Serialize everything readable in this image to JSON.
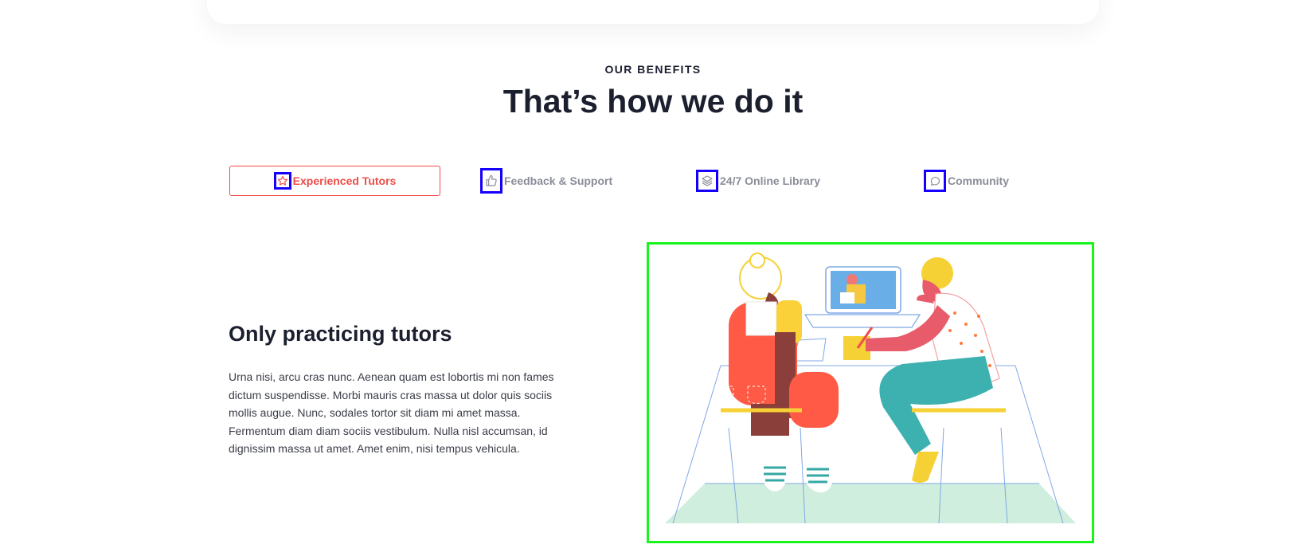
{
  "section": {
    "eyebrow": "OUR BENEFITS",
    "headline": "That’s how we do it"
  },
  "tabs": [
    {
      "label": "Experienced Tutors",
      "icon": "star-icon",
      "active": true
    },
    {
      "label": "Feedback & Support",
      "icon": "thumbs-up-icon",
      "active": false
    },
    {
      "label": "24/7 Online Library",
      "icon": "layers-icon",
      "active": false
    },
    {
      "label": "Community",
      "icon": "chat-icon",
      "active": false
    }
  ],
  "content": {
    "title": "Only practicing tutors",
    "body": "Urna nisi, arcu cras nunc. Aenean quam est lobortis mi non fames dictum suspendisse. Morbi mauris cras massa ut dolor quis sociis mollis augue. Nunc, sodales tortor sit diam mi amet massa. Fermentum diam diam sociis vestibulum. Nulla nisl accumsan, id dignissim massa ut amet. Amet enim, nisi tempus vehicula."
  },
  "colors": {
    "accent": "#ef4d49",
    "text_dark": "#1b1f2e",
    "tab_inactive": "#8a8d99",
    "annotation_blue": "#1500ff",
    "annotation_green": "#17f51a"
  }
}
